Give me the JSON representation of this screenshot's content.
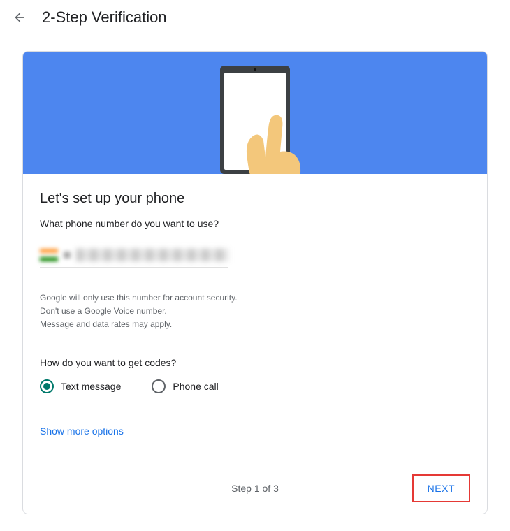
{
  "header": {
    "title": "2-Step Verification"
  },
  "main": {
    "heading": "Let's set up your phone",
    "subheading": "What phone number do you want to use?",
    "disclaimer": {
      "line1": "Google will only use this number for account security.",
      "line2": "Don't use a Google Voice number.",
      "line3": "Message and data rates may apply."
    },
    "codes_heading": "How do you want to get codes?",
    "radio": {
      "text_message": "Text message",
      "phone_call": "Phone call"
    },
    "show_more": "Show more options",
    "step_text": "Step 1 of 3",
    "next_label": "NEXT"
  }
}
